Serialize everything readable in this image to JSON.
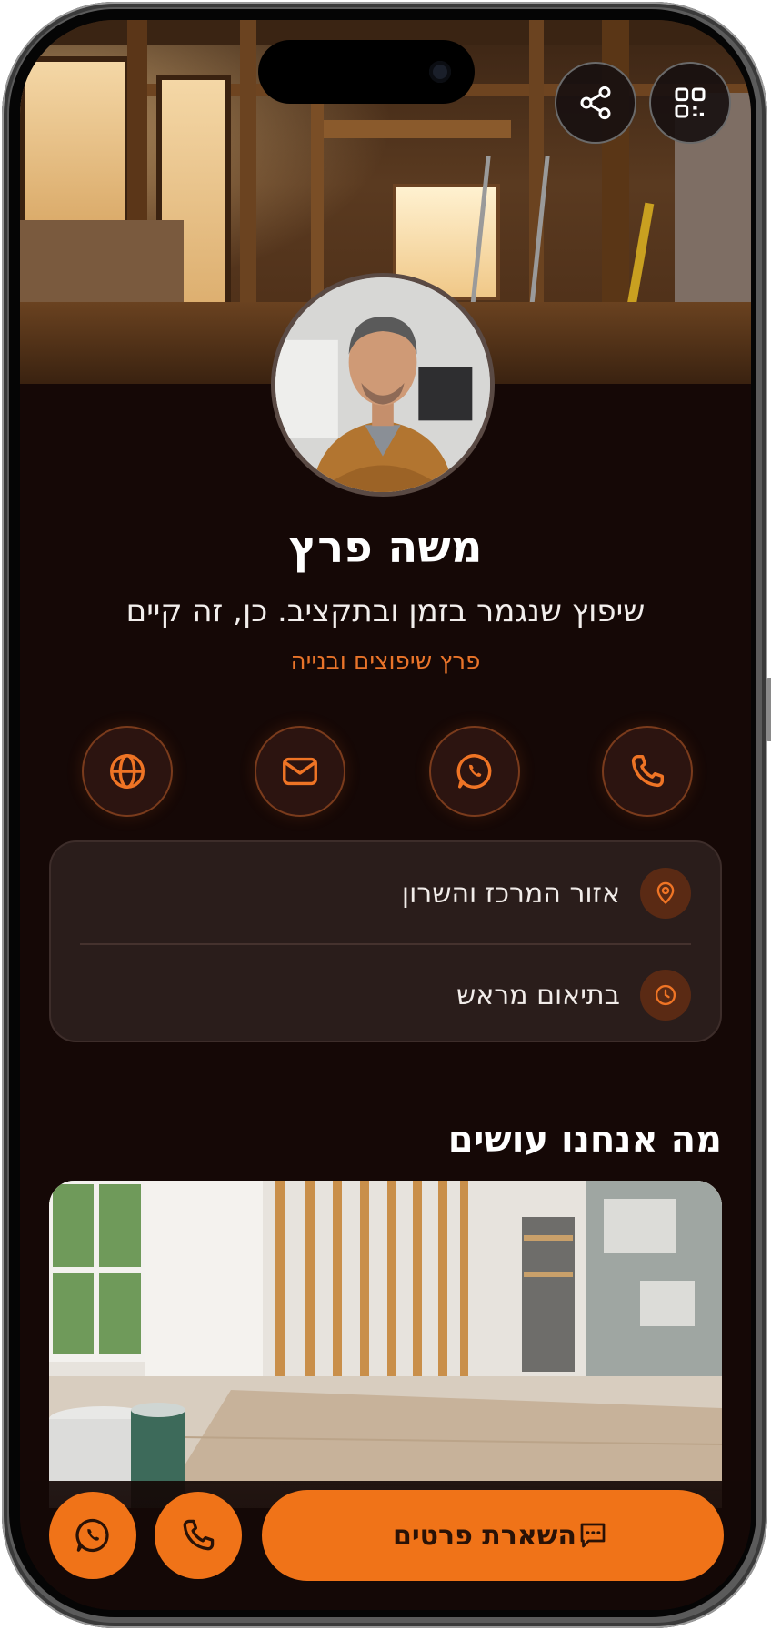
{
  "profile": {
    "name": "משה פרץ",
    "tagline": "שיפוץ שנגמר בזמן ובתקציב. כן, זה קיים",
    "company": "פרץ שיפוצים ובנייה"
  },
  "header_actions": {
    "share_icon": "share-icon",
    "qr_icon": "qr-code-icon"
  },
  "contact_actions": [
    {
      "icon": "globe-icon",
      "action": "website"
    },
    {
      "icon": "mail-icon",
      "action": "email"
    },
    {
      "icon": "whatsapp-icon",
      "action": "whatsapp"
    },
    {
      "icon": "phone-icon",
      "action": "phone"
    }
  ],
  "info": {
    "location": "אזור המרכז והשרון",
    "hours": "בתיאום מראש"
  },
  "section": {
    "title": "מה אנחנו עושים"
  },
  "bottom_bar": {
    "cta_label": "השארת פרטים",
    "cta_icon": "message-icon",
    "phone_icon": "phone-icon",
    "whatsapp_icon": "whatsapp-icon"
  },
  "colors": {
    "accent": "#f07318",
    "background": "#150806",
    "card": "#2a1d1b"
  }
}
